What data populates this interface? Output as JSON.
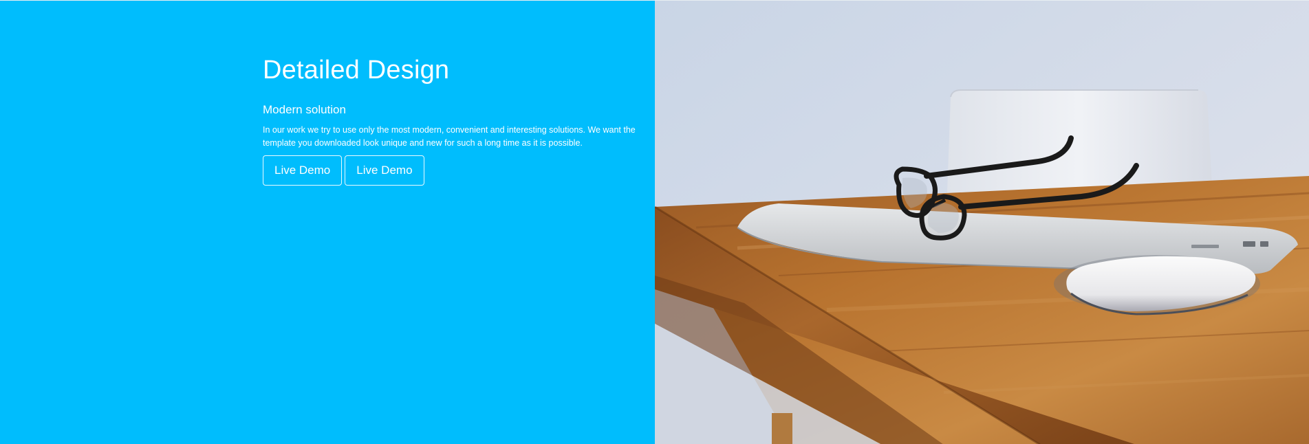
{
  "hero": {
    "title": "Detailed Design",
    "subtitle": "Modern solution",
    "description": "In our work we try to use only the most modern, convenient and interesting solutions. We want the template you downloaded look unique and new for such a long time as it is possible.",
    "buttons": [
      {
        "label": "Live Demo"
      },
      {
        "label": "Live Demo"
      }
    ]
  },
  "colors": {
    "accent": "#00bdfd",
    "text": "#ffffff"
  },
  "image": {
    "subject": "laptop-glasses-mouse-on-wooden-desk"
  }
}
